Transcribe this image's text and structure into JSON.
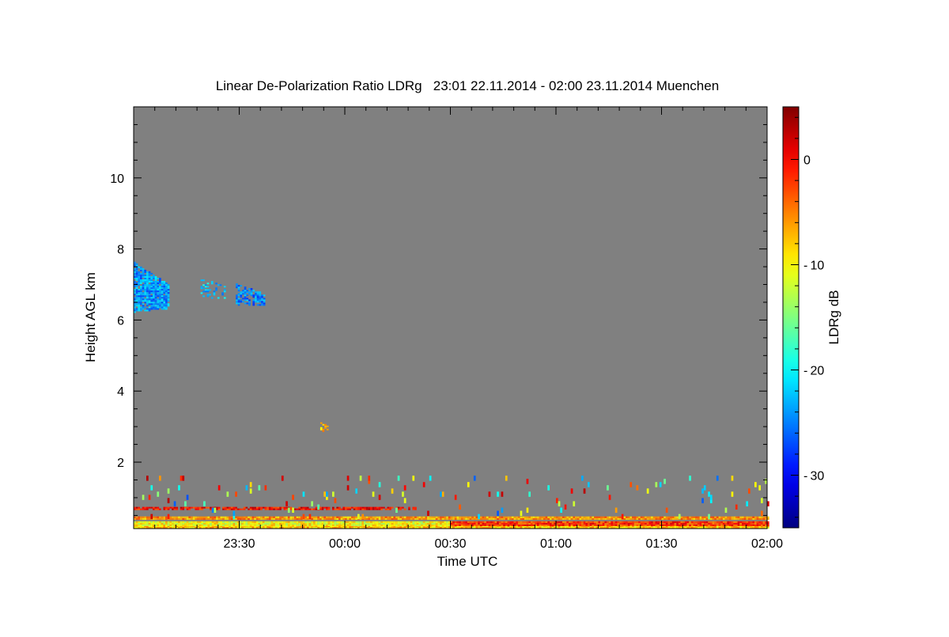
{
  "chart_data": {
    "type": "heatmap",
    "title": "Linear De-Polarization Ratio LDRg   23:01 22.11.2014 - 02:00 23.11.2014 Muenchen",
    "xlabel": "Time UTC",
    "ylabel": "Height AGL km",
    "xlim": [
      "23:00",
      "02:00"
    ],
    "ylim": [
      0.13,
      12
    ],
    "x_ticks": [
      "23:30",
      "00:00",
      "00:30",
      "01:00",
      "01:30",
      "02:00"
    ],
    "y_ticks": [
      "2",
      "4",
      "6",
      "8",
      "10"
    ],
    "background_color": "#808080",
    "colorbar": {
      "label": "LDRg dB",
      "range": [
        -35,
        5
      ],
      "colormap": "jet",
      "ticks": [
        "0",
        "-10",
        "-20",
        "-30"
      ]
    },
    "features": [
      {
        "name": "cirrus-1",
        "t": [
          "23:00",
          "23:10"
        ],
        "h": [
          6.2,
          7.6
        ],
        "ldr": -24,
        "density": 0.9
      },
      {
        "name": "cirrus-2",
        "t": [
          "23:19",
          "23:26"
        ],
        "h": [
          6.6,
          7.2
        ],
        "ldr": -22,
        "density": 0.25
      },
      {
        "name": "cirrus-3",
        "t": [
          "23:29",
          "23:37"
        ],
        "h": [
          6.4,
          7.0
        ],
        "ldr": -25,
        "density": 0.7
      },
      {
        "name": "aerosol-speck",
        "t": [
          "23:53",
          "23:55"
        ],
        "h": [
          2.85,
          3.1
        ],
        "ldr": -8,
        "density": 0.6
      },
      {
        "name": "surface-layer-low",
        "t": [
          "23:00",
          "02:00"
        ],
        "h": [
          0.13,
          0.2
        ],
        "ldr": -8,
        "density": 1
      },
      {
        "name": "surface-layer-early",
        "t": [
          "23:00",
          "00:30"
        ],
        "h": [
          0.2,
          0.3
        ],
        "ldr": -10,
        "density": 1
      },
      {
        "name": "surface-layer-late",
        "t": [
          "00:30",
          "02:00"
        ],
        "h": [
          0.2,
          0.3
        ],
        "ldr": -2,
        "density": 1
      },
      {
        "name": "layer-0.4km",
        "t": [
          "23:00",
          "02:00"
        ],
        "h": [
          0.38,
          0.44
        ],
        "ldr": -6,
        "density": 1
      },
      {
        "name": "red-line-0.7km",
        "t": [
          "23:00",
          "00:20"
        ],
        "h": [
          0.65,
          0.72
        ],
        "ldr": 0,
        "density": 0.8
      },
      {
        "name": "scattered-low",
        "t": [
          "23:00",
          "02:00"
        ],
        "h": [
          0.45,
          1.6
        ],
        "ldr": -12,
        "density": 0.03
      }
    ]
  }
}
